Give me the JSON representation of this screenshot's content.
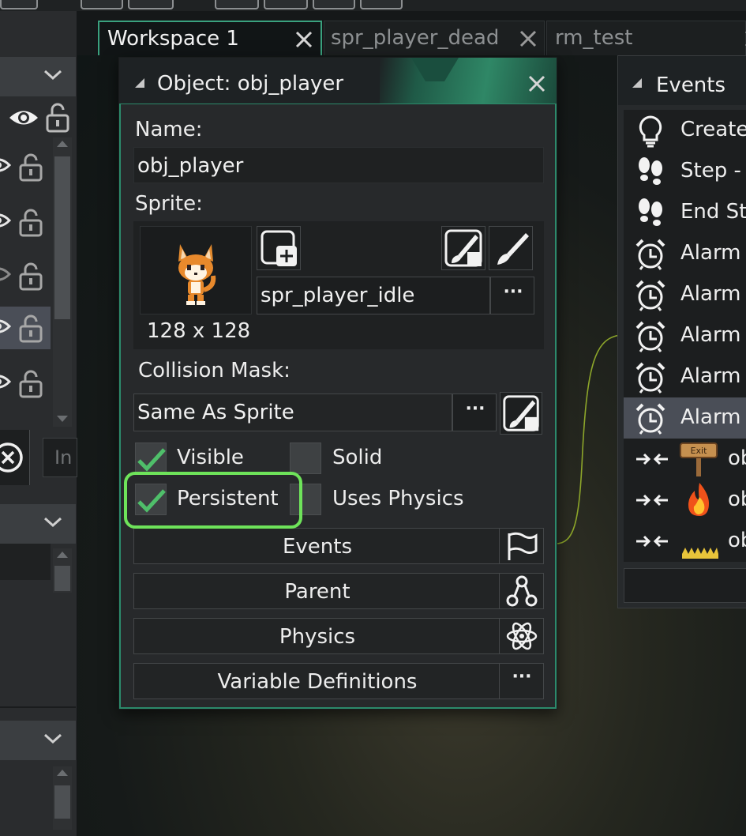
{
  "tabs": [
    {
      "label": "Workspace 1",
      "active": true
    },
    {
      "label": "spr_player_dead",
      "active": false
    },
    {
      "label": "rm_test",
      "active": false
    }
  ],
  "left_panel": {
    "search_placeholder": "In"
  },
  "object_editor": {
    "title": "Object: obj_player",
    "name_label": "Name:",
    "name_value": "obj_player",
    "sprite_label": "Sprite:",
    "sprite_size": "128 x 128",
    "sprite_name": "spr_player_idle",
    "browse_label": "···",
    "collision_mask_label": "Collision Mask:",
    "collision_mask_value": "Same As Sprite",
    "checkboxes": {
      "visible": {
        "label": "Visible",
        "checked": true
      },
      "solid": {
        "label": "Solid",
        "checked": false
      },
      "persistent": {
        "label": "Persistent",
        "checked": true
      },
      "uses_physics": {
        "label": "Uses Physics",
        "checked": false
      }
    },
    "buttons": {
      "events": "Events",
      "parent": "Parent",
      "physics": "Physics",
      "variable_definitions": "Variable Definitions",
      "more": "···"
    }
  },
  "events_panel": {
    "title": "Events",
    "items": [
      {
        "label": "Create",
        "icon": "lightbulb-icon"
      },
      {
        "label": "Step - B",
        "icon": "footsteps-icon"
      },
      {
        "label": "End Ste",
        "icon": "footsteps-icon"
      },
      {
        "label": "Alarm",
        "icon": "alarm-clock-icon"
      },
      {
        "label": "Alarm",
        "icon": "alarm-clock-icon"
      },
      {
        "label": "Alarm",
        "icon": "alarm-clock-icon"
      },
      {
        "label": "Alarm",
        "icon": "alarm-clock-icon"
      },
      {
        "label": "Alarm",
        "icon": "alarm-clock-icon",
        "selected": true
      },
      {
        "label": "ob",
        "icon": "collision-icon",
        "thumb": "exit-sign-icon"
      },
      {
        "label": "ob",
        "icon": "collision-icon",
        "thumb": "fire-icon"
      },
      {
        "label": "ob",
        "icon": "collision-icon",
        "thumb": "spikes-icon"
      }
    ]
  },
  "colors": {
    "accent": "#3aa17e",
    "highlight": "#6ee35a",
    "check": "#4fbf6a",
    "selected_row": "#4a4e57"
  }
}
